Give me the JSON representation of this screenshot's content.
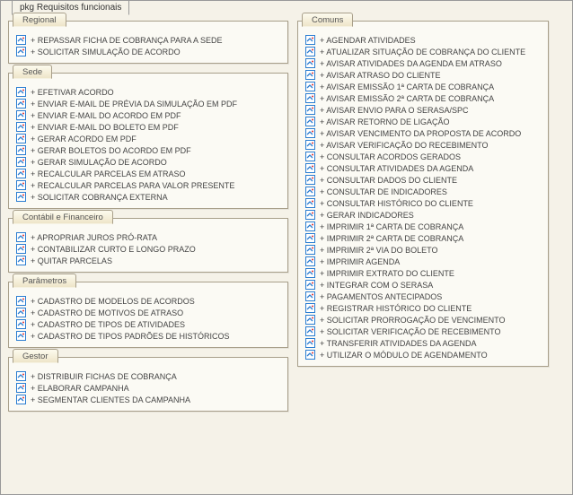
{
  "package": {
    "title": "pkg Requisitos funcionais"
  },
  "groups": {
    "regional": {
      "title": "Regional",
      "items": [
        "+ REPASSAR FICHA DE COBRANÇA PARA A SEDE",
        "+ SOLICITAR SIMULAÇÃO DE ACORDO"
      ]
    },
    "sede": {
      "title": "Sede",
      "items": [
        "+ EFETIVAR ACORDO",
        "+ ENVIAR E-MAIL DE PRÉVIA DA SIMULAÇÃO EM PDF",
        "+ ENVIAR E-MAIL DO ACORDO EM PDF",
        "+ ENVIAR E-MAIL DO BOLETO EM PDF",
        "+ GERAR ACORDO EM PDF",
        "+ GERAR BOLETOS DO ACORDO EM PDF",
        "+ GERAR SIMULAÇÃO DE ACORDO",
        "+ RECALCULAR PARCELAS EM ATRASO",
        "+ RECALCULAR PARCELAS PARA VALOR PRESENTE",
        "+ SOLICITAR COBRANÇA EXTERNA"
      ]
    },
    "contabil": {
      "title": "Contábil e Financeiro",
      "items": [
        "+ APROPRIAR JUROS PRÓ-RATA",
        "+ CONTABILIZAR CURTO E LONGO PRAZO",
        "+ QUITAR PARCELAS"
      ]
    },
    "parametros": {
      "title": "Parâmetros",
      "items": [
        "+ CADASTRO DE MODELOS DE ACORDOS",
        "+ CADASTRO DE MOTIVOS DE ATRASO",
        "+ CADASTRO DE TIPOS DE ATIVIDADES",
        "+ CADASTRO DE TIPOS PADRÕES DE HISTÓRICOS"
      ]
    },
    "gestor": {
      "title": "Gestor",
      "items": [
        "+ DISTRIBUIR FICHAS DE COBRANÇA",
        "+ ELABORAR CAMPANHA",
        "+ SEGMENTAR CLIENTES DA CAMPANHA"
      ]
    },
    "comuns": {
      "title": "Comuns",
      "items": [
        "+ AGENDAR ATIVIDADES",
        "+ ATUALIZAR SITUAÇÃO DE COBRANÇA DO CLIENTE",
        "+ AVISAR ATIVIDADES DA AGENDA EM ATRASO",
        "+ AVISAR ATRASO DO CLIENTE",
        "+ AVISAR EMISSÃO 1ª CARTA DE COBRANÇA",
        "+ AVISAR EMISSÃO 2ª CARTA DE COBRANÇA",
        "+ AVISAR ENVIO PARA O SERASA/SPC",
        "+ AVISAR RETORNO DE LIGAÇÃO",
        "+ AVISAR VENCIMENTO DA PROPOSTA DE ACORDO",
        "+ AVISAR VERIFICAÇÃO DO RECEBIMENTO",
        "+ CONSULTAR ACORDOS GERADOS",
        "+ CONSULTAR ATIVIDADES DA AGENDA",
        "+ CONSULTAR DADOS DO CLIENTE",
        "+ CONSULTAR DE INDICADORES",
        "+ CONSULTAR HISTÓRICO DO CLIENTE",
        "+ GERAR INDICADORES",
        "+ IMPRIMIR 1ª CARTA DE COBRANÇA",
        "+ IMPRIMIR 2ª CARTA DE COBRANÇA",
        "+ IMPRIMIR 2ª VIA DO BOLETO",
        "+ IMPRIMIR AGENDA",
        "+ IMPRIMIR EXTRATO DO CLIENTE",
        "+ INTEGRAR COM O SERASA",
        "+ PAGAMENTOS ANTECIPADOS",
        "+ REGISTRAR HISTÓRICO DO CLIENTE",
        "+ SOLICITAR PRORROGAÇÃO DE VENCIMENTO",
        "+ SOLICITAR VERIFICAÇÃO DE RECEBIMENTO",
        "+ TRANSFERIR ATIVIDADES DA AGENDA",
        "+ UTILIZAR O MÓDULO DE AGENDAMENTO"
      ]
    }
  }
}
